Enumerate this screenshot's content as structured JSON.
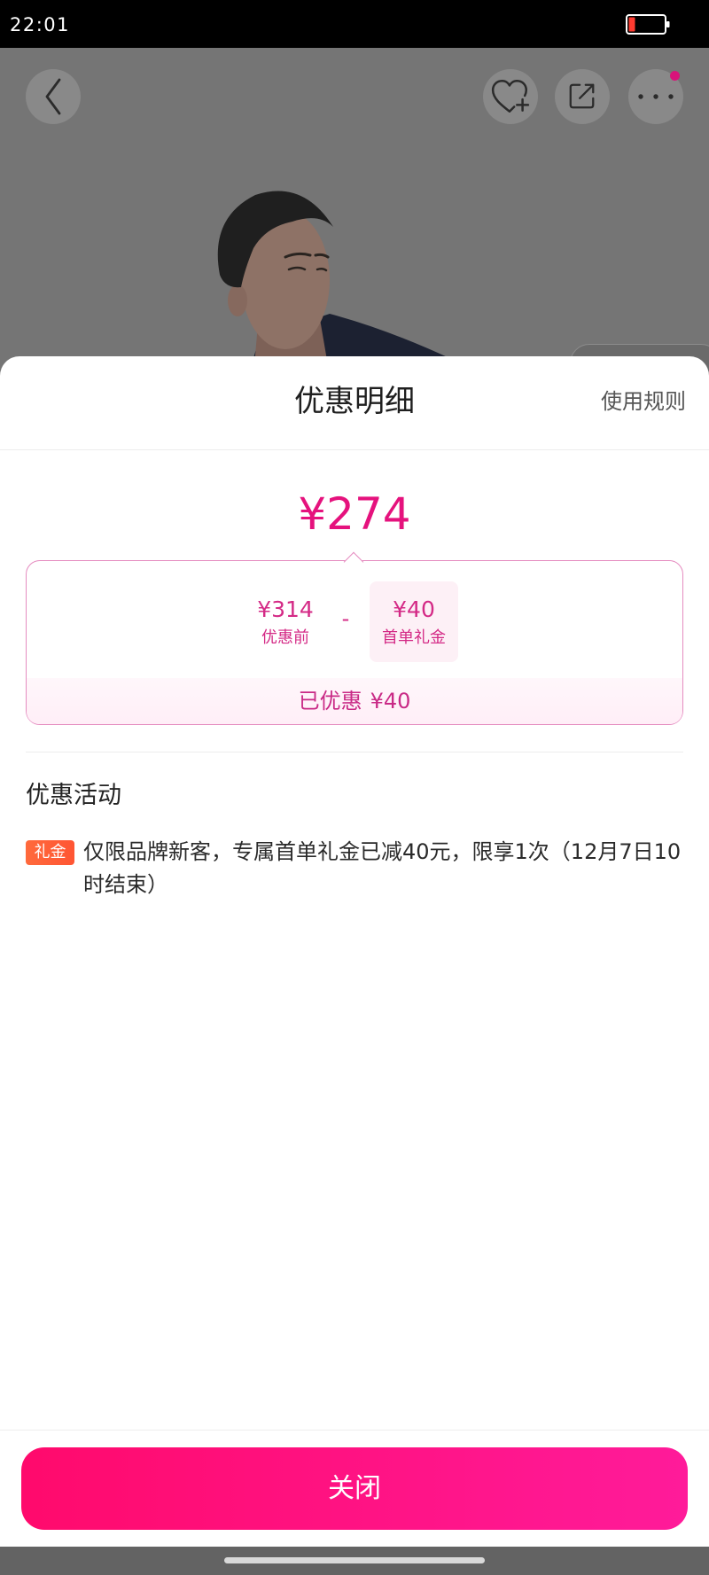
{
  "status_bar": {
    "time": "22:01",
    "battery_icon": "battery-low-icon"
  },
  "top_nav": {
    "back_icon": "chevron-left-icon",
    "favorite_icon": "heart-plus-icon",
    "share_icon": "share-icon",
    "more_icon": "more-dots-icon",
    "more_has_badge": true
  },
  "theme": {
    "accent": "#e5127d",
    "accent_soft": "#d42a86",
    "button_gradient_start": "#ff0a6c",
    "button_gradient_end": "#ff1b9a",
    "tag_color": "#ff5533",
    "box_border": "#e58cc0"
  },
  "discount_sheet": {
    "title": "优惠明细",
    "rules_link": "使用规则",
    "final_price": "¥274",
    "breakdown": {
      "original_amount": "¥314",
      "original_label": "优惠前",
      "operator": "-",
      "gift_amount": "¥40",
      "gift_label": "首单礼金",
      "saved_label": "已优惠",
      "saved_amount": "¥40"
    },
    "promotions_heading": "优惠活动",
    "promotions": [
      {
        "tag": "礼金",
        "description": "仅限品牌新客，专属首单礼金已减40元，限享1次（12月7日10时结束）"
      }
    ],
    "close_button": "关闭"
  }
}
